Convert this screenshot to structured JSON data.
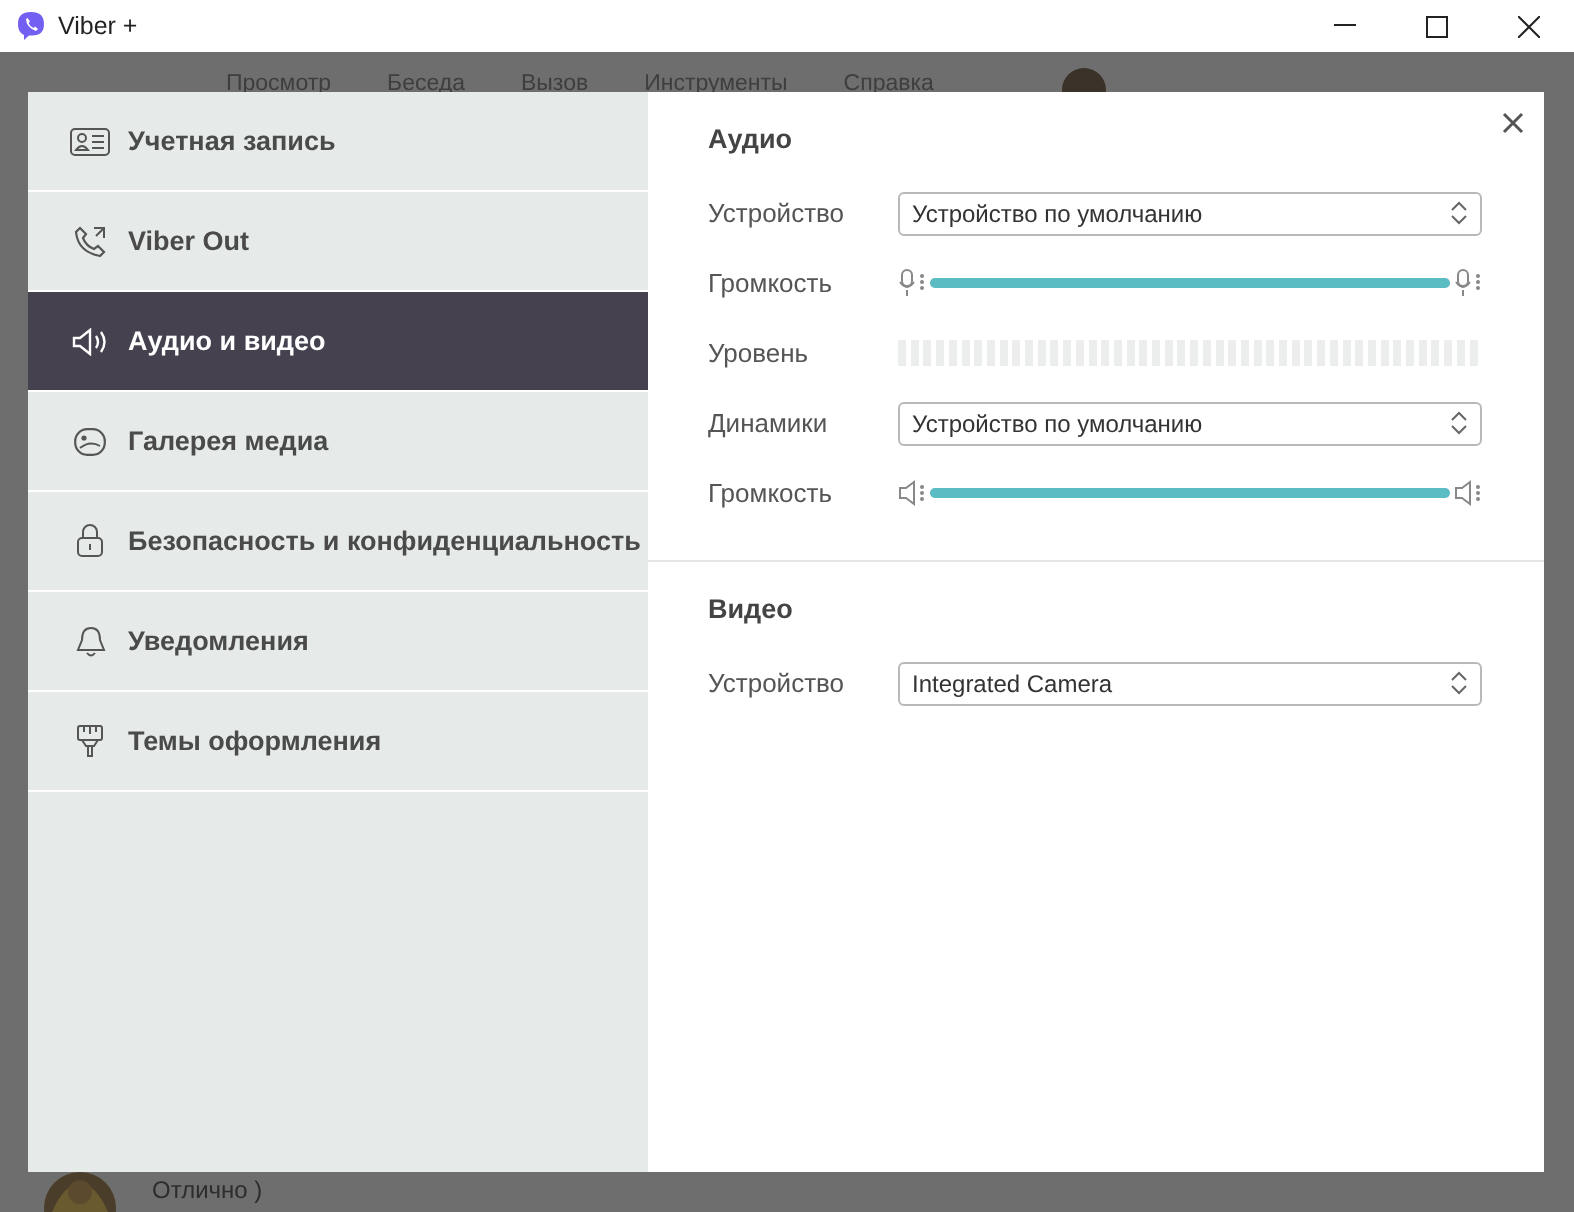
{
  "window": {
    "title": "Viber +"
  },
  "background": {
    "menu": [
      "Просмотр",
      "Беседа",
      "Вызов",
      "Инструменты",
      "Справка"
    ],
    "chat_preview": "Отлично )"
  },
  "dialog": {
    "nav": [
      {
        "label": "Учетная запись",
        "selected": false
      },
      {
        "label": "Viber Out",
        "selected": false
      },
      {
        "label": "Аудио и видео",
        "selected": true
      },
      {
        "label": "Галерея медиа",
        "selected": false
      },
      {
        "label": "Безопасность и конфиденциальность",
        "selected": false
      },
      {
        "label": "Уведомления",
        "selected": false
      },
      {
        "label": "Темы оформления",
        "selected": false
      }
    ],
    "sections": [
      {
        "title": "Аудио",
        "rows": [
          {
            "kind": "select",
            "label": "Устройство",
            "value": "Устройство по умолчанию"
          },
          {
            "kind": "slider",
            "label": "Громкость",
            "level": 1
          },
          {
            "kind": "meter",
            "label": "Уровень",
            "level": 0
          },
          {
            "kind": "select",
            "label": "Динамики",
            "value": "Устройство по умолчанию"
          },
          {
            "kind": "slider",
            "label": "Громкость",
            "level": 1
          }
        ]
      },
      {
        "title": "Видео",
        "rows": [
          {
            "kind": "select",
            "label": "Устройство",
            "value": "Integrated Camera"
          }
        ]
      }
    ]
  }
}
